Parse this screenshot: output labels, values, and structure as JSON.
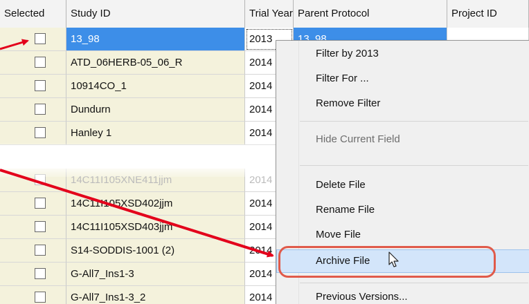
{
  "columns": [
    "Selected",
    "Study ID",
    "Trial Year",
    "Parent Protocol",
    "Project ID"
  ],
  "rows": [
    {
      "study_id": "13_98",
      "year": "2013",
      "parent": "13_98",
      "selected": true
    },
    {
      "study_id": "ATD_06HERB-05_06_R",
      "year": "2014",
      "parent": ""
    },
    {
      "study_id": "10914CO_1",
      "year": "2014",
      "parent": ""
    },
    {
      "study_id": "Dundurn",
      "year": "2014",
      "parent": ""
    },
    {
      "study_id": "Hanley 1",
      "year": "2014",
      "parent": ""
    },
    {
      "study_id": "14C11I105XNE411jjm",
      "year": "2014",
      "parent": "",
      "faded": true
    },
    {
      "study_id": "14C11I105XSD402jjm",
      "year": "2014",
      "parent": ""
    },
    {
      "study_id": "14C11I105XSD403jjm",
      "year": "2014",
      "parent": ""
    },
    {
      "study_id": "S14-SODDIS-1001 (2)",
      "year": "2014",
      "parent": ""
    },
    {
      "study_id": "G-All7_Ins1-3",
      "year": "2014",
      "parent": ""
    },
    {
      "study_id": "G-All7_Ins1-3_2",
      "year": "2014",
      "parent": ""
    }
  ],
  "context_menu": {
    "filter_by": "Filter by 2013",
    "filter_for": "Filter For ...",
    "remove_filter": "Remove Filter",
    "hide_field": "Hide Current Field",
    "delete_file": "Delete File",
    "rename_file": "Rename File",
    "move_file": "Move File",
    "archive_file": "Archive File",
    "previous_versions": "Previous Versions..."
  },
  "colors": {
    "selection": "#3d8ee8",
    "row_tint": "#f4f2dc",
    "annotation": "#e3001b",
    "highlight_ring": "#e05a4a",
    "menu_highlight": "#d3e5fa"
  },
  "icons": [
    "checkbox-icon",
    "mouse-pointer-icon",
    "annotation-arrow-icon"
  ]
}
